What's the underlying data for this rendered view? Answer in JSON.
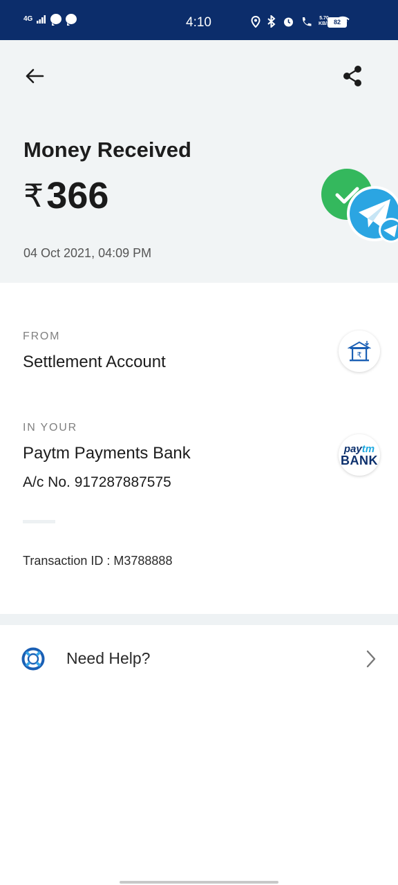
{
  "status_bar": {
    "network": "4G",
    "time": "4:10",
    "speed_value": "5.70",
    "speed_unit": "KB/s",
    "battery": "82"
  },
  "header": {
    "title": "Money Received",
    "currency_symbol": "₹",
    "amount": "366",
    "datetime": "04 Oct 2021, 04:09 PM"
  },
  "from": {
    "label": "FROM",
    "name": "Settlement Account"
  },
  "to": {
    "label": "IN YOUR",
    "bank": "Paytm Payments Bank",
    "account": "A/c No. 917287887575",
    "logo_top_pay": "pay",
    "logo_top_tm": "tm",
    "logo_bottom": "BANK"
  },
  "transaction": {
    "text": "Transaction ID :  M3788888"
  },
  "help": {
    "label": "Need Help?"
  },
  "colors": {
    "status_bar": "#0c2d6b",
    "header_bg": "#f1f4f5",
    "success_green": "#34b85d",
    "telegram_blue": "#2ba5e2",
    "paytm_navy": "#0b2f6c",
    "paytm_cyan": "#1fa9e0"
  },
  "icons": {
    "back": "arrow-left-icon",
    "share": "share-icon",
    "success": "check-circle-icon",
    "telegram": "telegram-icon",
    "bank": "bank-building-icon",
    "help": "lifebuoy-icon",
    "chevron": "chevron-right-icon"
  }
}
